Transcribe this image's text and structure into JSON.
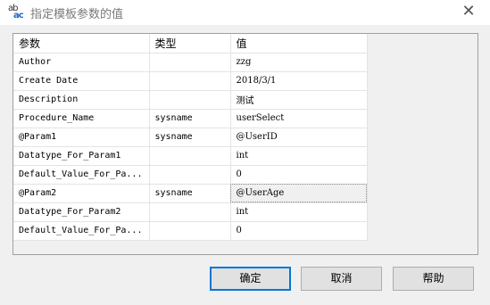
{
  "window": {
    "title": "指定模板参数的值",
    "app_icon_top": "ab",
    "app_icon_bottom": "ac",
    "close_glyph": "✕"
  },
  "grid": {
    "headers": [
      "参数",
      "类型",
      "值"
    ],
    "rows": [
      {
        "param": "Author",
        "type": "",
        "value": "zzg"
      },
      {
        "param": "Create Date",
        "type": "",
        "value": "2018/3/1"
      },
      {
        "param": "Description",
        "type": "",
        "value": "测试"
      },
      {
        "param": "Procedure_Name",
        "type": "sysname",
        "value": "userSelect"
      },
      {
        "param": "@Param1",
        "type": "sysname",
        "value": "@UserID"
      },
      {
        "param": "Datatype_For_Param1",
        "type": "",
        "value": "int"
      },
      {
        "param": "Default_Value_For_Pa...",
        "type": "",
        "value": "0"
      },
      {
        "param": "@Param2",
        "type": "sysname",
        "value": "@UserAge"
      },
      {
        "param": "Datatype_For_Param2",
        "type": "",
        "value": "int"
      },
      {
        "param": "Default_Value_For_Pa...",
        "type": "",
        "value": "0"
      }
    ],
    "selected_row": 7
  },
  "buttons": {
    "ok": "确定",
    "cancel": "取消",
    "help": "帮助"
  },
  "colors": {
    "accent": "#0078d7",
    "window_bg": "#f0f0f0",
    "title_text": "#7a7a7a"
  }
}
